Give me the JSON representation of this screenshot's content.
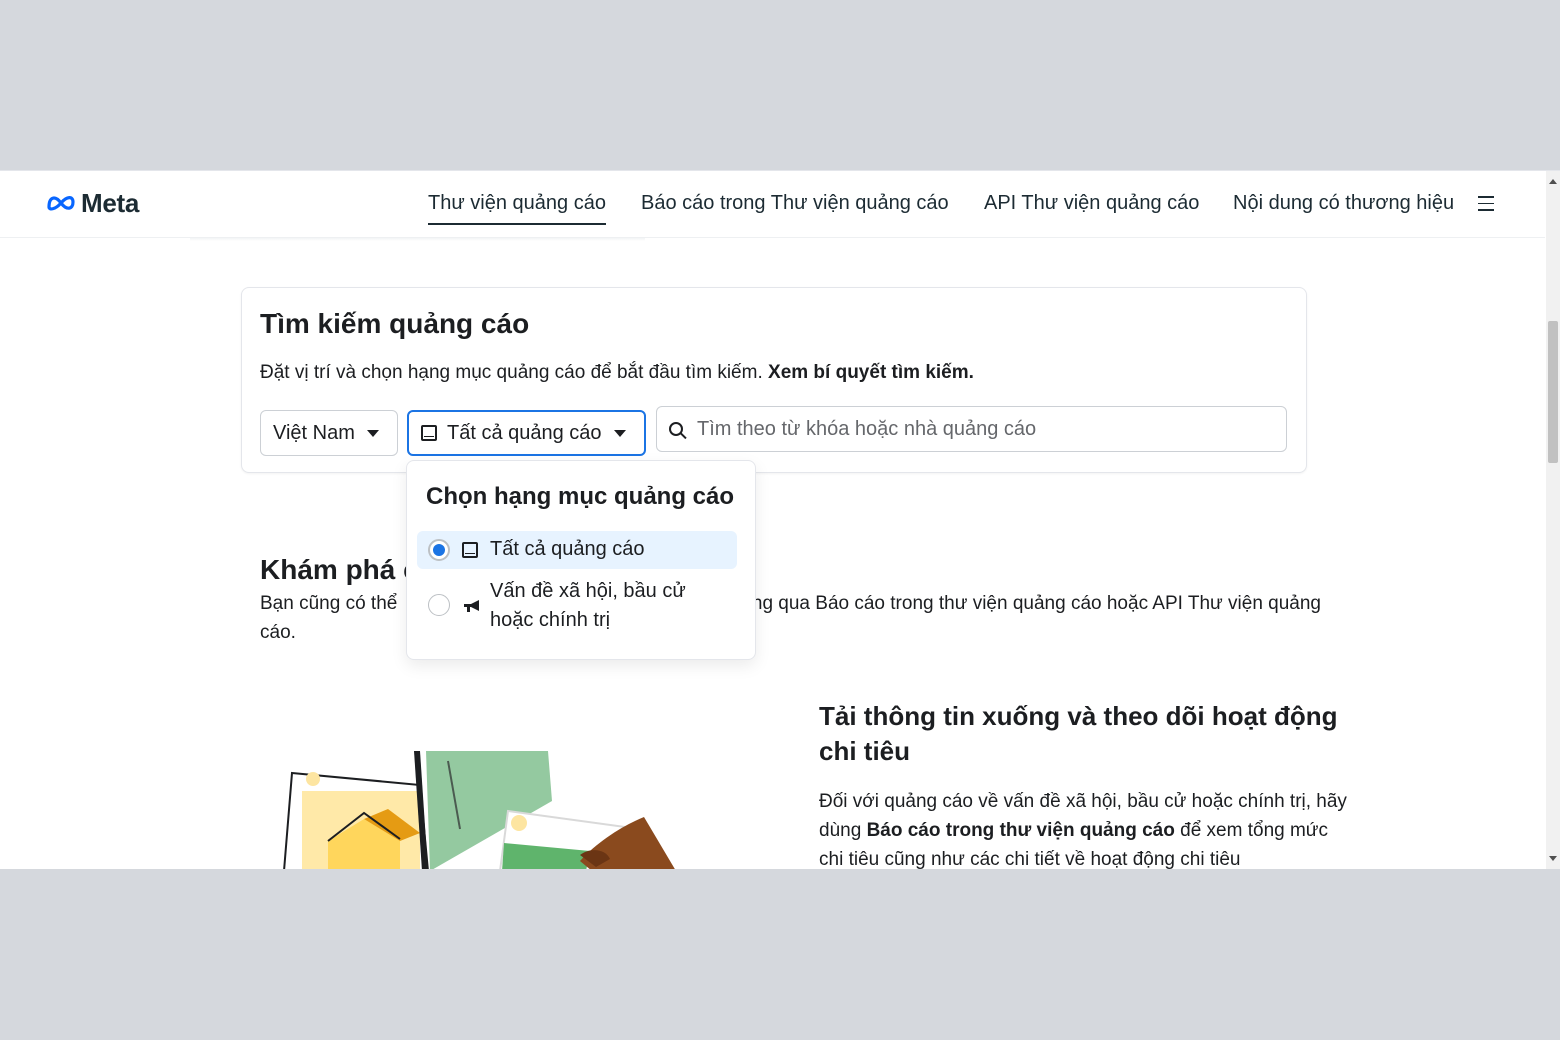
{
  "header": {
    "logo_text": "Meta",
    "nav": [
      {
        "label": "Thư viện quảng cáo",
        "active": true
      },
      {
        "label": "Báo cáo trong Thư viện quảng cáo"
      },
      {
        "label": "API Thư viện quảng cáo"
      },
      {
        "label": "Nội dung có thương hiệu"
      }
    ]
  },
  "search": {
    "title": "Tìm kiếm quảng cáo",
    "desc": "Đặt vị trí và chọn hạng mục quảng cáo để bắt đầu tìm kiếm.",
    "desc_link": "Xem bí quyết tìm kiếm.",
    "country": "Việt Nam",
    "category": "Tất cả quảng cáo",
    "placeholder": "Tìm theo từ khóa hoặc nhà quảng cáo"
  },
  "dropdown": {
    "title": "Chọn hạng mục quảng cáo",
    "options": [
      {
        "label": "Tất cả quảng cáo",
        "selected": true,
        "icon": "tablet-icon"
      },
      {
        "label_line1": "Vấn đề xã hội, bầu cử",
        "label_line2": "hoặc chính trị",
        "selected": false,
        "icon": "megaphone-icon"
      }
    ]
  },
  "explore": {
    "title_visible": "Khám phá c",
    "desc_left": "Bạn cũng có thể",
    "desc_right": "ng qua Báo cáo trong thư viện quảng cáo hoặc API Thư viện quảng",
    "desc_line2": "cáo."
  },
  "download": {
    "title": "Tải thông tin xuống và theo dõi hoạt động chi tiêu",
    "desc_1": "Đối với quảng cáo về vấn đề xã hội, bầu cử hoặc chính trị, hãy dùng",
    "desc_bold": "Báo cáo trong thư viện quảng cáo",
    "desc_2": "để xem tổng mức chi tiêu cũng như các chi tiết về hoạt động chi tiêu"
  },
  "colors": {
    "accent": "#1b74e4",
    "selected_bg": "#e7f3ff",
    "frame_bg": "#d5d8dd"
  }
}
